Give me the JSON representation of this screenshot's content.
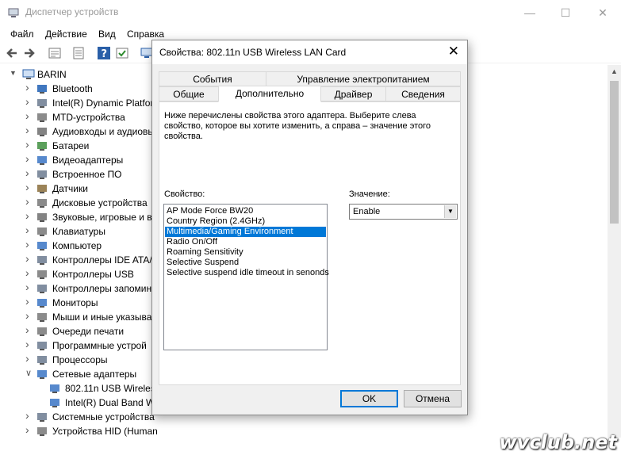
{
  "window": {
    "title": "Диспетчер устройств",
    "controls": [
      "—",
      "☐",
      "✕"
    ]
  },
  "menu": [
    "Файл",
    "Действие",
    "Вид",
    "Справка"
  ],
  "tree": {
    "root": "BARIN",
    "items": [
      {
        "label": "Bluetooth",
        "expanded": false,
        "color": "#1e5fb4"
      },
      {
        "label": "Intel(R) Dynamic Platfor",
        "expanded": false,
        "color": "#6b7a8f"
      },
      {
        "label": "MTD-устройства",
        "expanded": false,
        "color": "#777777"
      },
      {
        "label": "Аудиовходы и аудиовы",
        "expanded": false,
        "color": "#6d6d6d"
      },
      {
        "label": "Батареи",
        "expanded": false,
        "color": "#3f8f3f"
      },
      {
        "label": "Видеоадаптеры",
        "expanded": false,
        "color": "#3a74c4"
      },
      {
        "label": "Встроенное ПО",
        "expanded": false,
        "color": "#6b7a8f"
      },
      {
        "label": "Датчики",
        "expanded": false,
        "color": "#8a6d3b"
      },
      {
        "label": "Дисковые устройства",
        "expanded": false,
        "color": "#777777"
      },
      {
        "label": "Звуковые, игровые и в",
        "expanded": false,
        "color": "#6d6d6d"
      },
      {
        "label": "Клавиатуры",
        "expanded": false,
        "color": "#777777"
      },
      {
        "label": "Компьютер",
        "expanded": false,
        "color": "#3a74c4"
      },
      {
        "label": "Контроллеры IDE ATA/",
        "expanded": false,
        "color": "#6b7a8f"
      },
      {
        "label": "Контроллеры USB",
        "expanded": false,
        "color": "#777777"
      },
      {
        "label": "Контроллеры запомин",
        "expanded": false,
        "color": "#6b7a8f"
      },
      {
        "label": "Мониторы",
        "expanded": false,
        "color": "#3a74c4"
      },
      {
        "label": "Мыши и иные указыва",
        "expanded": false,
        "color": "#777777"
      },
      {
        "label": "Очереди печати",
        "expanded": false,
        "color": "#777777"
      },
      {
        "label": "Программные устрой",
        "expanded": false,
        "color": "#6b7a8f"
      },
      {
        "label": "Процессоры",
        "expanded": false,
        "color": "#6b7a8f"
      },
      {
        "label": "Сетевые адаптеры",
        "expanded": true,
        "color": "#3a74c4"
      },
      {
        "label": "802.11n USB Wireles",
        "child": true,
        "color": "#3a74c4"
      },
      {
        "label": "Intel(R) Dual Band W",
        "child": true,
        "color": "#3a74c4"
      },
      {
        "label": "Системные устройства",
        "expanded": false,
        "color": "#6b7a8f"
      },
      {
        "label": "Устройства HID (Human Interface Devices)",
        "expanded": false,
        "color": "#777777"
      }
    ]
  },
  "dialog": {
    "title": "Свойства: 802.11n USB Wireless LAN Card",
    "tabs_row1": [
      "События",
      "Управление электропитанием"
    ],
    "tabs_row2": [
      "Общие",
      "Дополнительно",
      "Драйвер",
      "Сведения"
    ],
    "active_tab": "Дополнительно",
    "description": "Ниже перечислены свойства этого адаптера. Выберите слева свойство, которое вы хотите изменить, а справа – значение этого свойства.",
    "property_label": "Свойство:",
    "value_label": "Значение:",
    "properties": [
      "AP Mode Force BW20",
      "Country Region (2.4GHz)",
      "Multimedia/Gaming Environment",
      "Radio On/Off",
      "Roaming Sensitivity",
      "Selective Suspend",
      "Selective suspend idle timeout in senonds"
    ],
    "selected_index": 2,
    "value": "Enable",
    "ok": "OK",
    "cancel": "Отмена",
    "accent_color": "#0078d7"
  },
  "watermark": "wvclub.net"
}
